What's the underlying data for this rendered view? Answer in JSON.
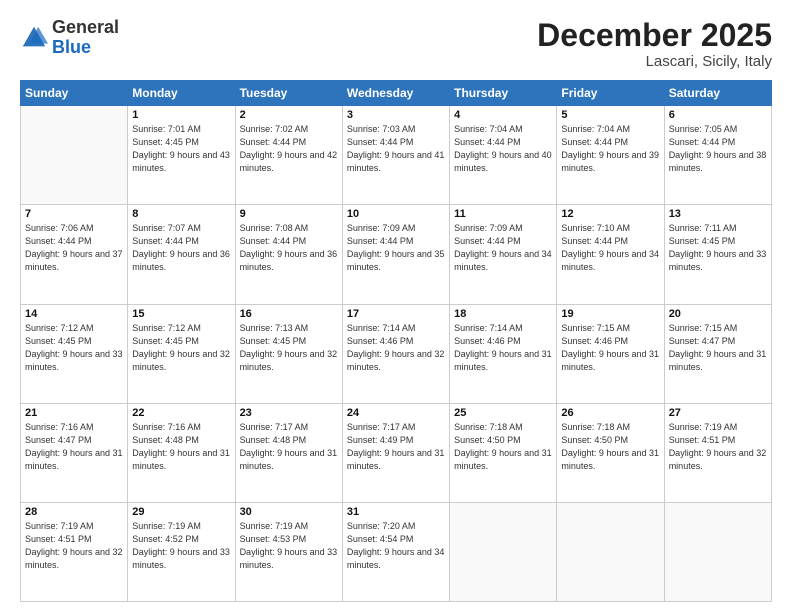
{
  "logo": {
    "general": "General",
    "blue": "Blue"
  },
  "header": {
    "month": "December 2025",
    "location": "Lascari, Sicily, Italy"
  },
  "weekdays": [
    "Sunday",
    "Monday",
    "Tuesday",
    "Wednesday",
    "Thursday",
    "Friday",
    "Saturday"
  ],
  "weeks": [
    [
      {
        "day": null
      },
      {
        "day": "1",
        "sunrise": "7:01 AM",
        "sunset": "4:45 PM",
        "daylight": "9 hours and 43 minutes."
      },
      {
        "day": "2",
        "sunrise": "7:02 AM",
        "sunset": "4:44 PM",
        "daylight": "9 hours and 42 minutes."
      },
      {
        "day": "3",
        "sunrise": "7:03 AM",
        "sunset": "4:44 PM",
        "daylight": "9 hours and 41 minutes."
      },
      {
        "day": "4",
        "sunrise": "7:04 AM",
        "sunset": "4:44 PM",
        "daylight": "9 hours and 40 minutes."
      },
      {
        "day": "5",
        "sunrise": "7:04 AM",
        "sunset": "4:44 PM",
        "daylight": "9 hours and 39 minutes."
      },
      {
        "day": "6",
        "sunrise": "7:05 AM",
        "sunset": "4:44 PM",
        "daylight": "9 hours and 38 minutes."
      }
    ],
    [
      {
        "day": "7",
        "sunrise": "7:06 AM",
        "sunset": "4:44 PM",
        "daylight": "9 hours and 37 minutes."
      },
      {
        "day": "8",
        "sunrise": "7:07 AM",
        "sunset": "4:44 PM",
        "daylight": "9 hours and 36 minutes."
      },
      {
        "day": "9",
        "sunrise": "7:08 AM",
        "sunset": "4:44 PM",
        "daylight": "9 hours and 36 minutes."
      },
      {
        "day": "10",
        "sunrise": "7:09 AM",
        "sunset": "4:44 PM",
        "daylight": "9 hours and 35 minutes."
      },
      {
        "day": "11",
        "sunrise": "7:09 AM",
        "sunset": "4:44 PM",
        "daylight": "9 hours and 34 minutes."
      },
      {
        "day": "12",
        "sunrise": "7:10 AM",
        "sunset": "4:44 PM",
        "daylight": "9 hours and 34 minutes."
      },
      {
        "day": "13",
        "sunrise": "7:11 AM",
        "sunset": "4:45 PM",
        "daylight": "9 hours and 33 minutes."
      }
    ],
    [
      {
        "day": "14",
        "sunrise": "7:12 AM",
        "sunset": "4:45 PM",
        "daylight": "9 hours and 33 minutes."
      },
      {
        "day": "15",
        "sunrise": "7:12 AM",
        "sunset": "4:45 PM",
        "daylight": "9 hours and 32 minutes."
      },
      {
        "day": "16",
        "sunrise": "7:13 AM",
        "sunset": "4:45 PM",
        "daylight": "9 hours and 32 minutes."
      },
      {
        "day": "17",
        "sunrise": "7:14 AM",
        "sunset": "4:46 PM",
        "daylight": "9 hours and 32 minutes."
      },
      {
        "day": "18",
        "sunrise": "7:14 AM",
        "sunset": "4:46 PM",
        "daylight": "9 hours and 31 minutes."
      },
      {
        "day": "19",
        "sunrise": "7:15 AM",
        "sunset": "4:46 PM",
        "daylight": "9 hours and 31 minutes."
      },
      {
        "day": "20",
        "sunrise": "7:15 AM",
        "sunset": "4:47 PM",
        "daylight": "9 hours and 31 minutes."
      }
    ],
    [
      {
        "day": "21",
        "sunrise": "7:16 AM",
        "sunset": "4:47 PM",
        "daylight": "9 hours and 31 minutes."
      },
      {
        "day": "22",
        "sunrise": "7:16 AM",
        "sunset": "4:48 PM",
        "daylight": "9 hours and 31 minutes."
      },
      {
        "day": "23",
        "sunrise": "7:17 AM",
        "sunset": "4:48 PM",
        "daylight": "9 hours and 31 minutes."
      },
      {
        "day": "24",
        "sunrise": "7:17 AM",
        "sunset": "4:49 PM",
        "daylight": "9 hours and 31 minutes."
      },
      {
        "day": "25",
        "sunrise": "7:18 AM",
        "sunset": "4:50 PM",
        "daylight": "9 hours and 31 minutes."
      },
      {
        "day": "26",
        "sunrise": "7:18 AM",
        "sunset": "4:50 PM",
        "daylight": "9 hours and 31 minutes."
      },
      {
        "day": "27",
        "sunrise": "7:19 AM",
        "sunset": "4:51 PM",
        "daylight": "9 hours and 32 minutes."
      }
    ],
    [
      {
        "day": "28",
        "sunrise": "7:19 AM",
        "sunset": "4:51 PM",
        "daylight": "9 hours and 32 minutes."
      },
      {
        "day": "29",
        "sunrise": "7:19 AM",
        "sunset": "4:52 PM",
        "daylight": "9 hours and 33 minutes."
      },
      {
        "day": "30",
        "sunrise": "7:19 AM",
        "sunset": "4:53 PM",
        "daylight": "9 hours and 33 minutes."
      },
      {
        "day": "31",
        "sunrise": "7:20 AM",
        "sunset": "4:54 PM",
        "daylight": "9 hours and 34 minutes."
      },
      {
        "day": null
      },
      {
        "day": null
      },
      {
        "day": null
      }
    ]
  ]
}
